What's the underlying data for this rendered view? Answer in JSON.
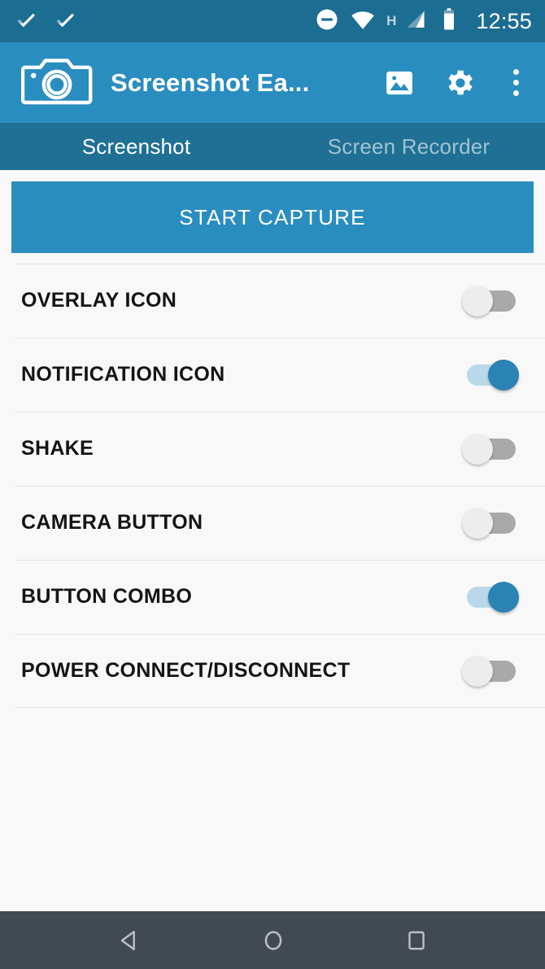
{
  "statusbar": {
    "icons_left": [
      "check-icon",
      "check-icon"
    ],
    "icons_right": [
      "do-not-disturb-icon",
      "wifi-icon",
      "signal-icon",
      "battery-icon"
    ],
    "network_type": "H",
    "clock": "12:55",
    "background": "#1c6d92"
  },
  "appbar": {
    "logo": "camera-icon",
    "title": "Screenshot Ea...",
    "background": "#2a8dc0",
    "actions": [
      {
        "name": "gallery-icon",
        "label": "Gallery"
      },
      {
        "name": "settings-gear-icon",
        "label": "Settings"
      },
      {
        "name": "overflow-menu-icon",
        "label": "More options"
      }
    ]
  },
  "tabs": {
    "background": "#1f7094",
    "items": [
      {
        "label": "Screenshot",
        "active": true
      },
      {
        "label": "Screen Recorder",
        "active": false
      }
    ]
  },
  "main": {
    "capture_button": {
      "label": "START CAPTURE",
      "color": "#2a8dc0"
    },
    "settings": [
      {
        "label": "OVERLAY ICON",
        "state": "off"
      },
      {
        "label": "NOTIFICATION ICON",
        "state": "on"
      },
      {
        "label": "SHAKE",
        "state": "off"
      },
      {
        "label": "CAMERA BUTTON",
        "state": "off"
      },
      {
        "label": "BUTTON COMBO",
        "state": "on"
      },
      {
        "label": "POWER CONNECT/DISCONNECT",
        "state": "off"
      }
    ],
    "switch_on_color": "#2a82b5",
    "switch_off_color": "#a9a9a9",
    "background": "#f8f8f8"
  },
  "navbar": {
    "background": "#414a52",
    "buttons": [
      {
        "name": "back-icon",
        "label": "Back"
      },
      {
        "name": "home-icon",
        "label": "Home"
      },
      {
        "name": "recents-icon",
        "label": "Recent apps"
      }
    ]
  }
}
